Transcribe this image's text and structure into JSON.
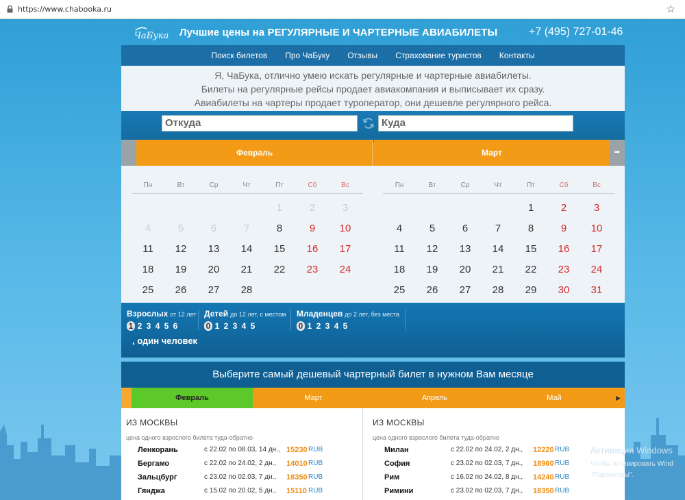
{
  "browser": {
    "url": "https://www.chabooka.ru"
  },
  "header": {
    "headline": "Лучшие цены на РЕГУЛЯРНЫЕ И ЧАРТЕРНЫЕ АВИАБИЛЕТЫ",
    "phone": "+7 (495) 727-01-46",
    "logo_text": "ЧаБука"
  },
  "nav": {
    "items": [
      {
        "label": "Поиск билетов"
      },
      {
        "label": "Про ЧаБуку"
      },
      {
        "label": "Отзывы"
      },
      {
        "label": "Страхование туристов"
      },
      {
        "label": "Контакты"
      }
    ]
  },
  "intro": {
    "lines": [
      "Я, ЧаБука, отлично умею искать регулярные и чартерные авиабилеты.",
      "Билеты на регулярные рейсы продает авиакомпания и выписывает их сразу.",
      "Авиабилеты на чартеры продает туроператор, они дешевле регулярного рейса."
    ]
  },
  "search": {
    "from_placeholder": "Откуда",
    "to_placeholder": "Куда"
  },
  "months": {
    "left": "Февраль",
    "right": "Март"
  },
  "calendar": {
    "weekdays": [
      "Пн",
      "Вт",
      "Ср",
      "Чт",
      "Пт",
      "Сб",
      "Вс"
    ],
    "february": [
      [
        "",
        "",
        "",
        "",
        "1",
        "2",
        "3"
      ],
      [
        "4",
        "5",
        "6",
        "7",
        "8",
        "9",
        "10"
      ],
      [
        "11",
        "12",
        "13",
        "14",
        "15",
        "16",
        "17"
      ],
      [
        "18",
        "19",
        "20",
        "21",
        "22",
        "23",
        "24"
      ],
      [
        "25",
        "26",
        "27",
        "28",
        "",
        "",
        ""
      ]
    ],
    "february_muted_through": "7",
    "march": [
      [
        "",
        "",
        "",
        "",
        "1",
        "2",
        "3"
      ],
      [
        "4",
        "5",
        "6",
        "7",
        "8",
        "9",
        "10"
      ],
      [
        "11",
        "12",
        "13",
        "14",
        "15",
        "16",
        "17"
      ],
      [
        "18",
        "19",
        "20",
        "21",
        "22",
        "23",
        "24"
      ],
      [
        "25",
        "26",
        "27",
        "28",
        "29",
        "30",
        "31"
      ]
    ]
  },
  "passengers": {
    "adults": {
      "title": "Взрослых",
      "sub": "от 12 лет",
      "options": [
        "1",
        "2",
        "3",
        "4",
        "5",
        "6"
      ],
      "selected": "1"
    },
    "children": {
      "title": "Детей",
      "sub": "до 12 лет, с местом",
      "options": [
        "0",
        "1",
        "2",
        "3",
        "4",
        "5"
      ],
      "selected": "0"
    },
    "infants": {
      "title": "Младенцев",
      "sub": "до 2 лет, без места",
      "options": [
        "0",
        "1",
        "2",
        "3",
        "4",
        "5"
      ],
      "selected": "0"
    },
    "summary": ", один человек"
  },
  "charter": {
    "title": "Выберите самый дешевый чартерный билет в нужном Вам месяце",
    "tabs": [
      "Февраль",
      "Март",
      "Апрель",
      "Май"
    ],
    "active_tab": "Февраль",
    "columns": [
      {
        "heading": "ИЗ МОСКВЫ",
        "sub": "цена одного взрослого билета туда-обратно",
        "rows": [
          {
            "city": "Ленкорань",
            "dates": "с 22.02 по 08.03, 14 дн.,",
            "price": "15230",
            "currency": "RUB"
          },
          {
            "city": "Бергамо",
            "dates": "с 22.02 по 24.02, 2 дн.,",
            "price": "14010",
            "currency": "RUB"
          },
          {
            "city": "Зальцбург",
            "dates": "с 23.02 по 02.03, 7 дн.,",
            "price": "18350",
            "currency": "RUB"
          },
          {
            "city": "Гянджа",
            "dates": "с 15.02 по 20.02, 5 дн.,",
            "price": "15110",
            "currency": "RUB"
          }
        ]
      },
      {
        "heading": "ИЗ МОСКВЫ",
        "sub": "цена одного взрослого билета туда-обратно",
        "rows": [
          {
            "city": "Милан",
            "dates": "с 22.02 по 24.02, 2 дн.,",
            "price": "12220",
            "currency": "RUB"
          },
          {
            "city": "София",
            "dates": "с 23.02 по 02.03, 7 дн.,",
            "price": "18960",
            "currency": "RUB"
          },
          {
            "city": "Рим",
            "dates": "с 16.02 по 24.02, 8 дн.,",
            "price": "14240",
            "currency": "RUB"
          },
          {
            "city": "Римини",
            "dates": "с 23.02 по 02.03, 7 дн.,",
            "price": "18350",
            "currency": "RUB"
          }
        ]
      }
    ]
  },
  "watermark": {
    "line1": "Активация Windows",
    "line2": "Чтобы активировать Wind",
    "line3": "\"Параметры\"."
  },
  "colors": {
    "orange": "#f39b16",
    "nav_blue": "#1b6ea6",
    "green_tab": "#5cc829",
    "weekend_red": "#d42b2b"
  }
}
